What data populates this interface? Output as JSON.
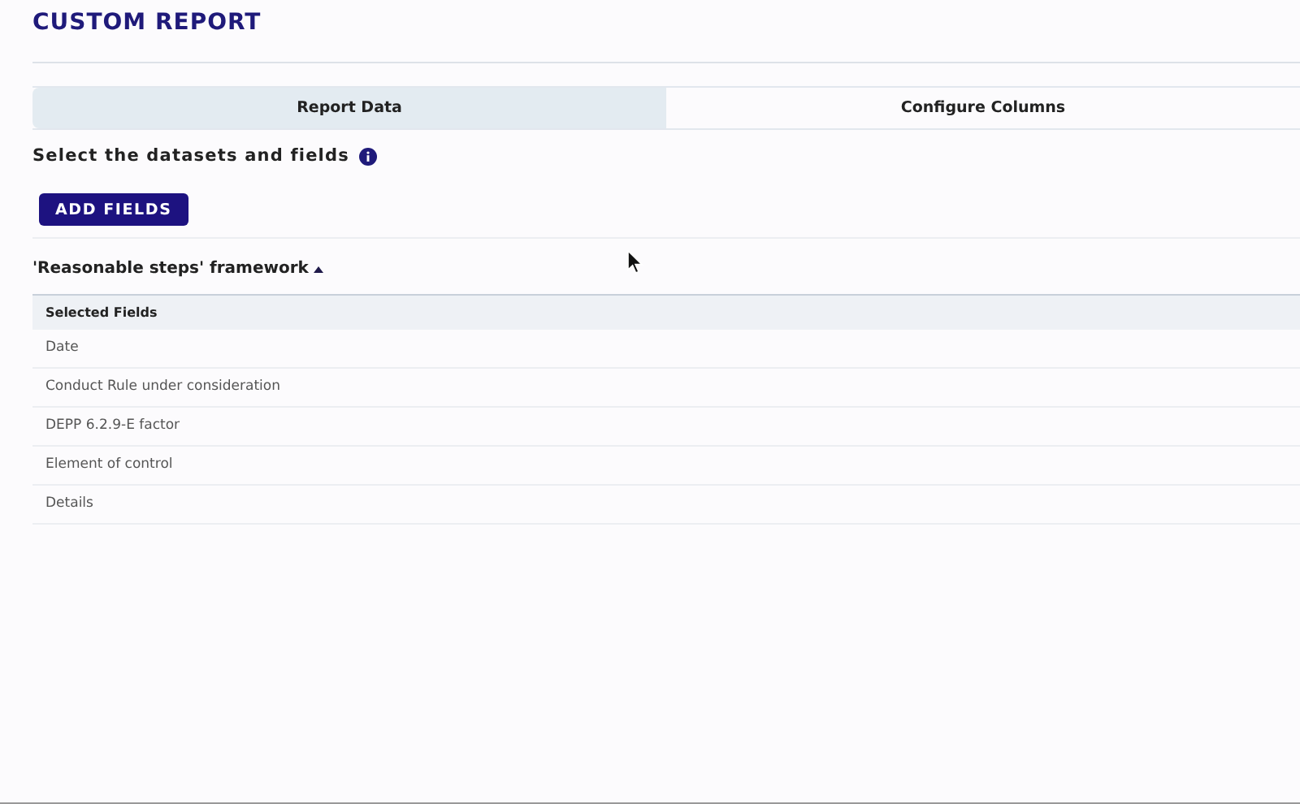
{
  "page": {
    "title": "CUSTOM REPORT"
  },
  "tabs": [
    {
      "label": "Report Data",
      "selected": true
    },
    {
      "label": "Configure Columns",
      "selected": false
    }
  ],
  "section": {
    "heading": "Select the datasets and fields",
    "button": "ADD FIELDS"
  },
  "dataset": {
    "name": "'Reasonable steps' framework",
    "expanded": true
  },
  "table": {
    "columns": [
      "Selected Fields"
    ],
    "rows": [
      "Date",
      "Conduct Rule under consideration",
      "DEPP 6.2.9-E factor",
      "Element of control",
      "Details"
    ]
  }
}
